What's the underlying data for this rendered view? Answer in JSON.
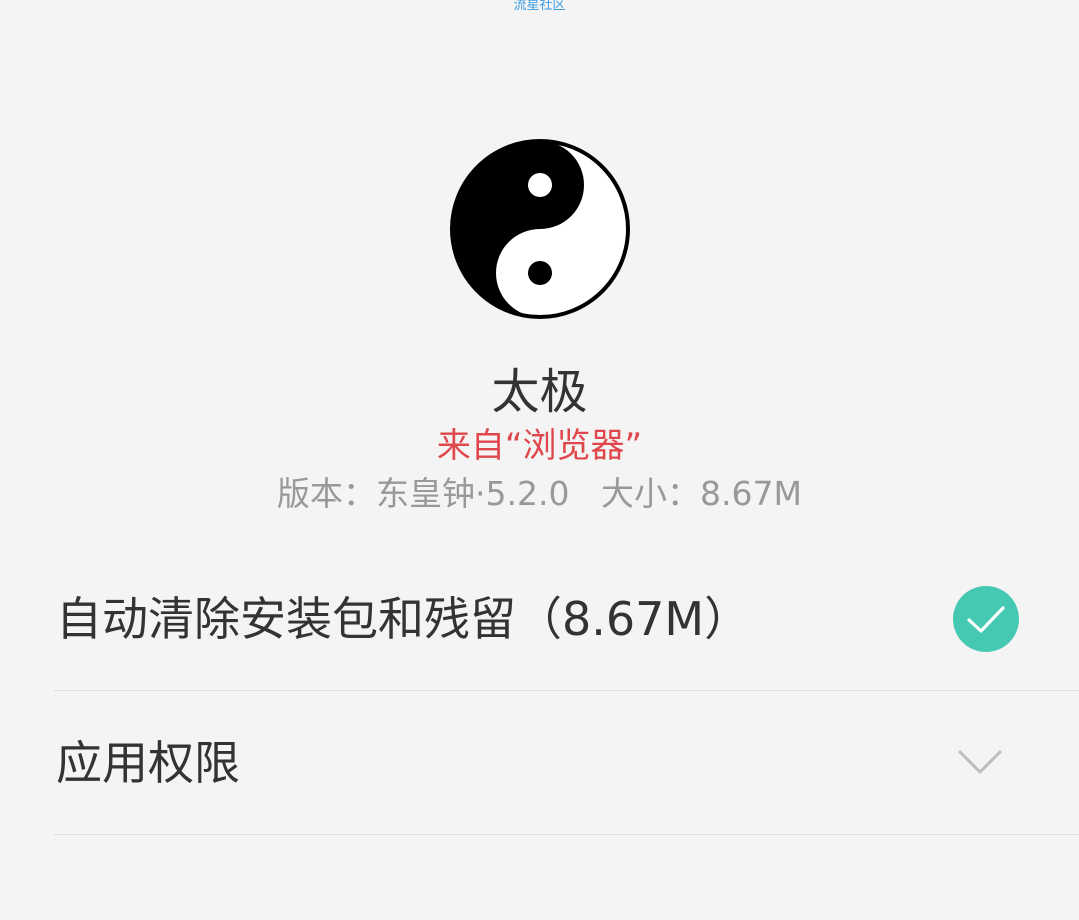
{
  "watermark": "流星社区",
  "app": {
    "icon": "taiji-yin-yang-icon",
    "name": "太极",
    "source": "来自“浏览器”",
    "version_label": "版本：东皇钟·5.2.0",
    "size_label": "大小：8.67M"
  },
  "options": {
    "cleanup": {
      "label": "自动清除安装包和残留（8.67M）",
      "checked": true,
      "icon": "check-circle-icon"
    },
    "permissions": {
      "label": "应用权限",
      "icon": "chevron-down-icon"
    }
  },
  "colors": {
    "background": "#f4f4f4",
    "source_red": "#e0474c",
    "check_teal": "#46c9b3",
    "meta_gray": "#999999",
    "watermark_blue": "#3d9be0"
  }
}
